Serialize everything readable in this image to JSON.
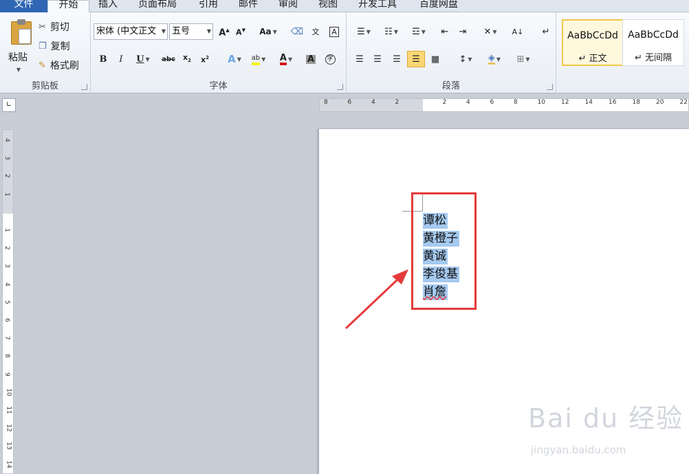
{
  "tabs": {
    "file": "文件",
    "home": "开始",
    "insert": "插入",
    "layout": "页面布局",
    "references": "引用",
    "mailings": "邮件",
    "review": "审阅",
    "view": "视图",
    "developer": "开发工具",
    "baidu": "百度网盘"
  },
  "clipboard": {
    "paste": "粘贴",
    "cut": "剪切",
    "copy": "复制",
    "format_painter": "格式刷",
    "group_label": "剪贴板"
  },
  "font": {
    "name": "宋体 (中文正文",
    "size": "五号",
    "group_label": "字体"
  },
  "paragraph": {
    "group_label": "段落"
  },
  "styles": {
    "normal_sample": "AaBbCcDd",
    "normal_name": "↵ 正文",
    "nospacing_sample": "AaBbCcDd",
    "nospacing_name": "↵ 无间隔"
  },
  "ruler_h_ticks": [
    "8",
    "6",
    "4",
    "2",
    "",
    "2",
    "4",
    "6",
    "8",
    "10",
    "12",
    "14",
    "16",
    "18",
    "20",
    "22"
  ],
  "ruler_v_ticks": [
    "4",
    "3",
    "2",
    "1",
    "",
    "1",
    "2",
    "3",
    "4",
    "5",
    "6",
    "7",
    "8",
    "9",
    "10",
    "11",
    "12",
    "13",
    "14"
  ],
  "document": {
    "lines": [
      "谭松",
      "黄橙子",
      "黄诚",
      "李俊基",
      "肖詹"
    ]
  },
  "watermark": {
    "brand": "Bai du 经验",
    "url": "jingyan.baidu.com"
  },
  "colors": {
    "file_tab": "#2f66b3",
    "selection": "#a5c9ef",
    "annotation": "#e53a3a"
  }
}
